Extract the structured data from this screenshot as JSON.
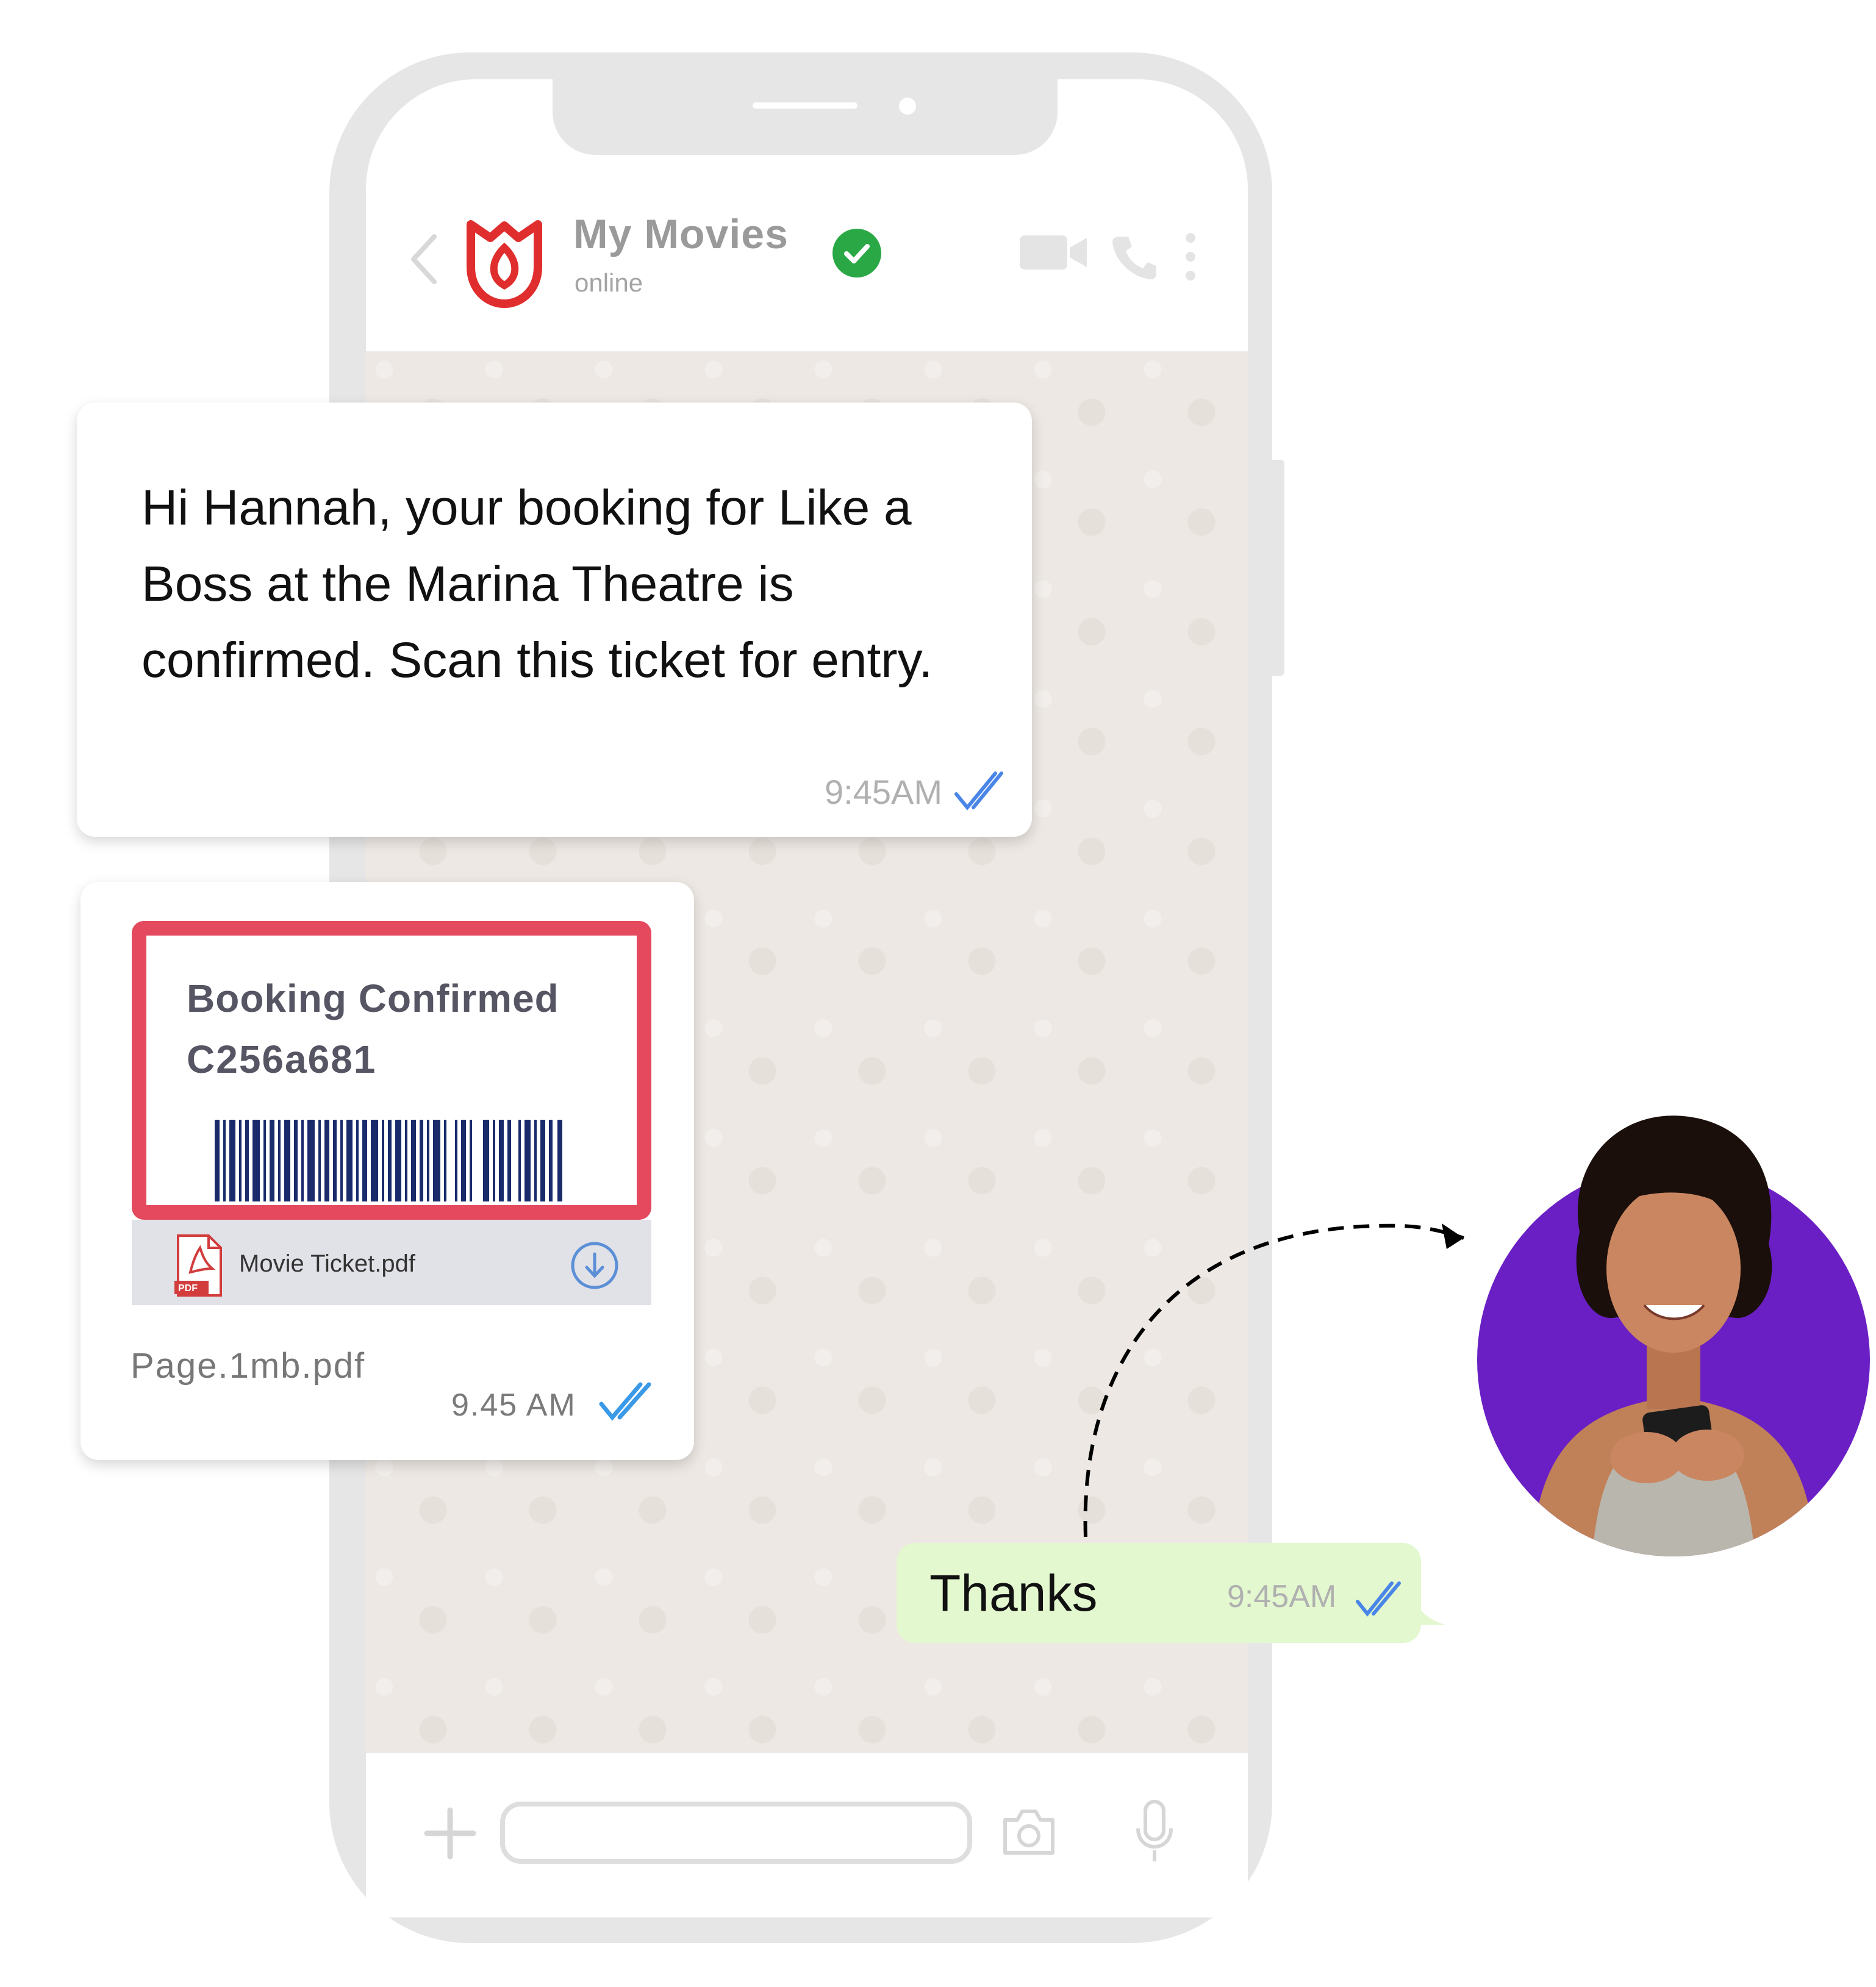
{
  "header": {
    "contact_name": "My Movies",
    "status": "online",
    "icons": [
      "back-arrow-icon",
      "brand-logo",
      "verified-check-icon",
      "video-call-icon",
      "phone-call-icon",
      "more-menu-icon"
    ]
  },
  "messages": [
    {
      "direction": "incoming",
      "text": "Hi Hannah, your booking for Like a Boss at the Marina Theatre is confirmed. Scan this ticket for entry.",
      "time": "9:45AM",
      "read": true
    },
    {
      "direction": "incoming",
      "type": "attachment",
      "preview_title": "Booking Confirmed",
      "preview_code": "C256a681",
      "file_name": "Movie Ticket.pdf",
      "file_type": "PDF",
      "caption": "Page.1mb.pdf",
      "time": "9.45 AM",
      "read": true
    },
    {
      "direction": "outgoing",
      "text": "Thanks",
      "time": "9:45AM",
      "read": true
    }
  ],
  "input_bar": {
    "placeholder": "",
    "icons": [
      "plus-icon",
      "camera-icon",
      "microphone-icon"
    ]
  },
  "colors": {
    "accent_red": "#e4495e",
    "verified_green": "#2aa845",
    "tick_blue": "#4a86e8",
    "outgoing_bubble": "#e3f8cf",
    "chat_background": "#ede8e3",
    "avatar_background": "#6a1fc4"
  }
}
